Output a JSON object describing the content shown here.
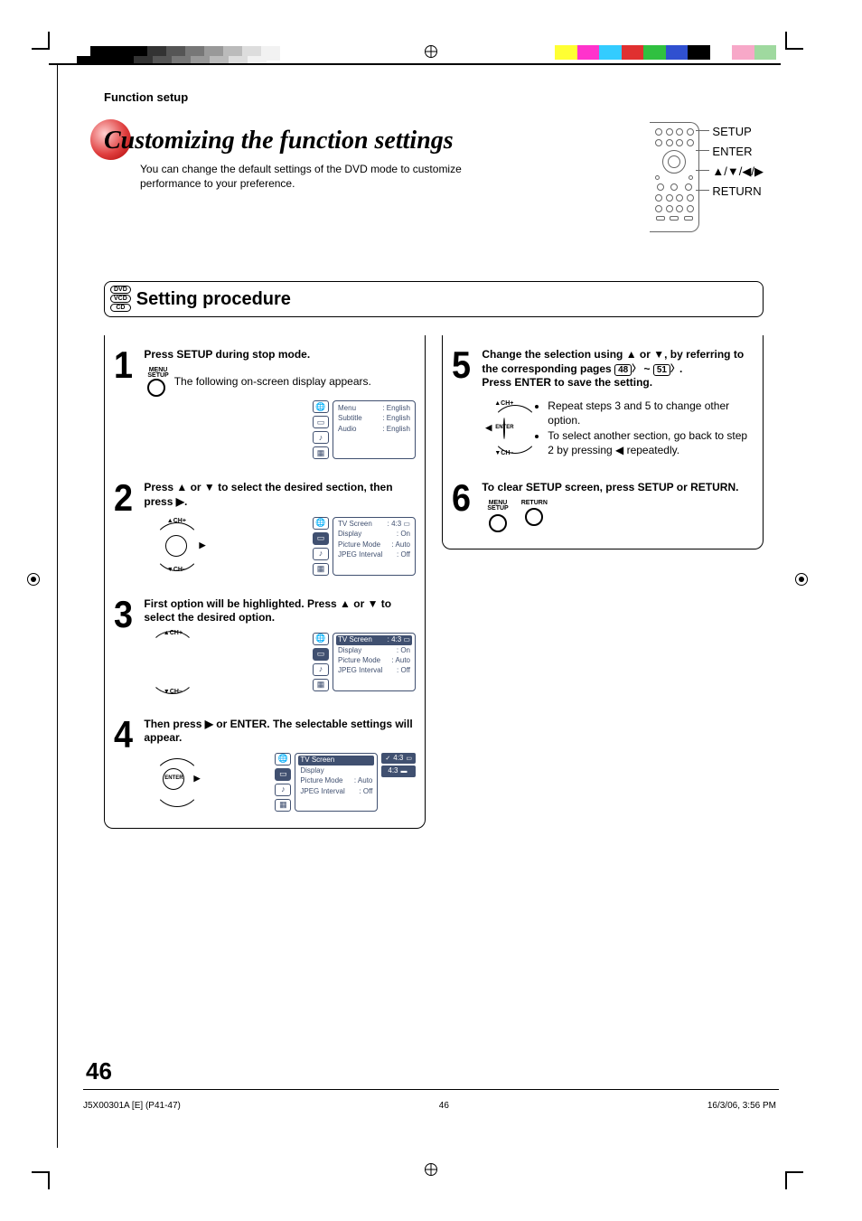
{
  "header": {
    "section_label": "Function setup"
  },
  "title": "Customizing the function settings",
  "subtitle": "You can change the default settings of the DVD mode to customize performance to your preference.",
  "remote_labels": {
    "setup": "SETUP",
    "enter": "ENTER",
    "arrows": "▲/▼/◀/▶",
    "return": "RETURN"
  },
  "proc_heading": "Setting procedure",
  "disc_types": [
    "DVD",
    "VCD",
    "CD"
  ],
  "steps": {
    "1": {
      "lead": "Press SETUP during stop mode.",
      "body": "The following on-screen display appears.",
      "btn_label": "MENU\nSETUP"
    },
    "2": {
      "lead": "Press ▲ or ▼ to select the desired section, then press ▶.",
      "wheel": {
        "up": "▲CH+",
        "down": "▼CH–",
        "right": "▶"
      }
    },
    "3": {
      "lead": "First option will be highlighted. Press ▲ or ▼ to select the desired option.",
      "wheel": {
        "up": "▲CH+",
        "down": "▼CH–"
      }
    },
    "4": {
      "lead": "Then press ▶ or ENTER. The selectable settings will appear.",
      "wheel": {
        "center": "ENTER",
        "right": "▶"
      }
    },
    "5": {
      "lead_a": "Change the selection using ▲ or ▼, by referring to the corresponding pages ",
      "page_from": "48",
      "tilde": " ~ ",
      "page_to": "51",
      "lead_b": ".\nPress ENTER to save the setting.",
      "wheel": {
        "up": "▲CH+",
        "down": "▼CH–",
        "center": "ENTER",
        "left": "◀"
      },
      "bullet1": "Repeat steps 3 and 5 to change other option.",
      "bullet2": "To select another section, go back to step 2 by pressing ◀ repeatedly."
    },
    "6": {
      "lead": "To clear SETUP screen, press SETUP or RETURN.",
      "btn1": "MENU\nSETUP",
      "btn2": "RETURN"
    }
  },
  "osd": {
    "menu1": [
      {
        "label": "Menu",
        "value": ": English"
      },
      {
        "label": "Subtitle",
        "value": ": English"
      },
      {
        "label": "Audio",
        "value": ": English"
      }
    ],
    "menu2": [
      {
        "label": "TV Screen",
        "value": ": 4:3 ▭",
        "sel": false
      },
      {
        "label": "Display",
        "value": ": On"
      },
      {
        "label": "Picture Mode",
        "value": ": Auto"
      },
      {
        "label": "JPEG Interval",
        "value": ": Off"
      }
    ],
    "menu3": [
      {
        "label": "TV Screen",
        "value": ": 4:3 ▭",
        "sel": true
      },
      {
        "label": "Display",
        "value": ": On"
      },
      {
        "label": "Picture Mode",
        "value": ": Auto"
      },
      {
        "label": "JPEG Interval",
        "value": ": Off"
      }
    ],
    "menu4": {
      "rows": [
        {
          "label": "TV Screen",
          "sel": true
        },
        {
          "label": "Display"
        },
        {
          "label": "Picture Mode",
          "value": ": Auto"
        },
        {
          "label": "JPEG Interval",
          "value": ": Off"
        }
      ],
      "opts": [
        {
          "checked": true,
          "label": "4:3",
          "icon": "▭"
        },
        {
          "checked": false,
          "label": "4:3",
          "icon": "▬"
        }
      ]
    }
  },
  "page_number": "46",
  "footer": {
    "left": "J5X00301A [E] (P41-47)",
    "center": "46",
    "right": "16/3/06, 3:56 PM"
  },
  "greyscale": [
    "#000",
    "#000",
    "#000",
    "#333",
    "#555",
    "#777",
    "#999",
    "#bbb",
    "#ddd",
    "#f2f2f2"
  ],
  "colors": [
    "#ffff33",
    "#ff33cc",
    "#33ccff",
    "#e03030",
    "#30c040",
    "#3050d0",
    "#000",
    "#fff",
    "#f7a8c8",
    "#9fd99f"
  ]
}
